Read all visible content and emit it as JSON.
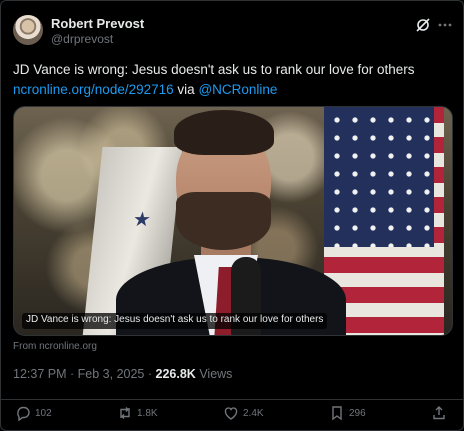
{
  "author": {
    "name": "Robert Prevost",
    "handle": "@drprevost"
  },
  "icons": {
    "grok": "grok-icon",
    "more": "more-icon",
    "reply": "reply-icon",
    "repost": "repost-icon",
    "like": "heart-icon",
    "bookmark": "bookmark-icon",
    "share": "share-icon"
  },
  "tweet": {
    "text": "JD Vance is wrong: Jesus doesn't ask us to rank our love for others",
    "link": "ncronline.org/node/292716",
    "via": "via",
    "mention": "@NCRonline"
  },
  "media": {
    "caption": "JD Vance is wrong: Jesus doesn't ask us to rank our love for others",
    "source": "From ncronline.org"
  },
  "meta": {
    "time": "12:37 PM",
    "separator": "·",
    "date": "Feb 3, 2025",
    "views_count": "226.8K",
    "views_label": "Views"
  },
  "actions": {
    "replies": "102",
    "reposts": "1.8K",
    "likes": "2.4K",
    "bookmarks": "296"
  },
  "colors": {
    "background": "#000000",
    "text": "#e7e9ea",
    "secondary": "#71767b",
    "link": "#1d9bf0",
    "border": "#2f3336"
  }
}
